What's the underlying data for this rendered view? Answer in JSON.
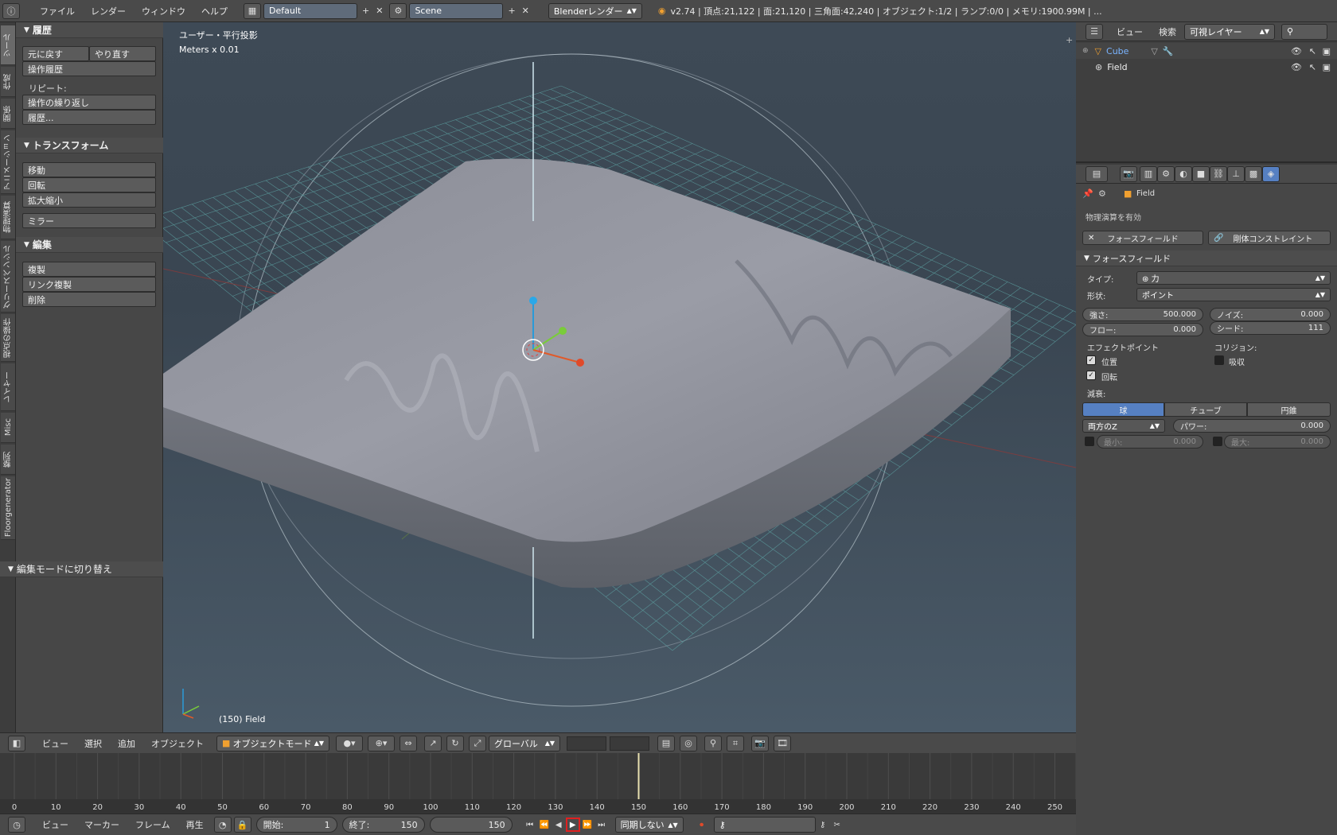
{
  "topbar": {
    "menus": [
      "ファイル",
      "レンダー",
      "ウィンドウ",
      "ヘルプ"
    ],
    "screen_layout": "Default",
    "scene": "Scene",
    "render_engine": "Blenderレンダー",
    "stats": "v2.74 | 頂点:21,122 | 面:21,120 | 三角面:42,240 | オブジェクト:1/2 | ランプ:0/0 | メモリ:1900.99M | ..."
  },
  "vtabs": [
    "ツール",
    "作成",
    "関係",
    "アニメーション",
    "物理演算",
    "グリースペンシル",
    "視点の操作",
    "レイヤー",
    "Misc",
    "整列",
    "Floorgenerator"
  ],
  "toolshelf": {
    "history": {
      "title": "履歴",
      "undo": "元に戻す",
      "redo": "やり直す",
      "undo_history": "操作履歴",
      "repeat_label": "リピート:",
      "repeat_last": "操作の繰り返し",
      "repeat_history": "履歴..."
    },
    "transform": {
      "title": "トランスフォーム",
      "move": "移動",
      "rotate": "回転",
      "scale": "拡大縮小",
      "mirror": "ミラー"
    },
    "edit": {
      "title": "編集",
      "duplicate": "複製",
      "duplicate_linked": "リンク複製",
      "delete": "削除"
    },
    "mode_panel": "編集モードに切り替え"
  },
  "viewport": {
    "view_name": "ユーザー・平行投影",
    "units": "Meters x 0.01",
    "frame_object": "(150) Field"
  },
  "vp_header": {
    "menus": [
      "ビュー",
      "選択",
      "追加",
      "オブジェクト"
    ],
    "mode": "オブジェクトモード",
    "orientation": "グローバル"
  },
  "timeline": {
    "ticks": [
      0,
      10,
      20,
      30,
      40,
      50,
      60,
      70,
      80,
      90,
      100,
      110,
      120,
      130,
      140,
      150,
      160,
      170,
      180,
      190,
      200,
      210,
      220,
      230,
      240,
      250
    ],
    "current_frame": 150,
    "menus": [
      "ビュー",
      "マーカー",
      "フレーム",
      "再生"
    ],
    "start_label": "開始:",
    "start_value": "1",
    "end_label": "終了:",
    "end_value": "150",
    "current_value": "150",
    "sync": "同期しない"
  },
  "outliner": {
    "menus": [
      "ビュー",
      "検索"
    ],
    "filter": "可視レイヤー",
    "items": [
      "Cube",
      "Field"
    ]
  },
  "properties": {
    "object_name": "Field",
    "enable_label": "物理演算を有効",
    "force_field_btn": "フォースフィールド",
    "rigid_constraint_btn": "剛体コンストレイント",
    "panel_title": "フォースフィールド",
    "type_label": "タイプ:",
    "type_value": "力",
    "shape_label": "形状:",
    "shape_value": "ポイント",
    "strength_label": "強さ:",
    "strength_value": "500.000",
    "noise_label": "ノイズ:",
    "noise_value": "0.000",
    "flow_label": "フロー:",
    "flow_value": "0.000",
    "seed_label": "シード:",
    "seed_value": "111",
    "effect_point_label": "エフェクトポイント",
    "collision_label": "コリジョン:",
    "location_label": "位置",
    "rotation_label": "回転",
    "absorb_label": "吸収",
    "falloff_label": "減衰:",
    "falloff_tabs": [
      "球",
      "チューブ",
      "円錐"
    ],
    "falloff_axis": "両方のZ",
    "power_label": "パワー:",
    "power_value": "0.000",
    "min_label": "最小:",
    "min_value": "0.000",
    "max_label": "最大:",
    "max_value": "0.000"
  },
  "colors": {
    "accent": "#5680c2",
    "play_highlight": "#e02020"
  }
}
